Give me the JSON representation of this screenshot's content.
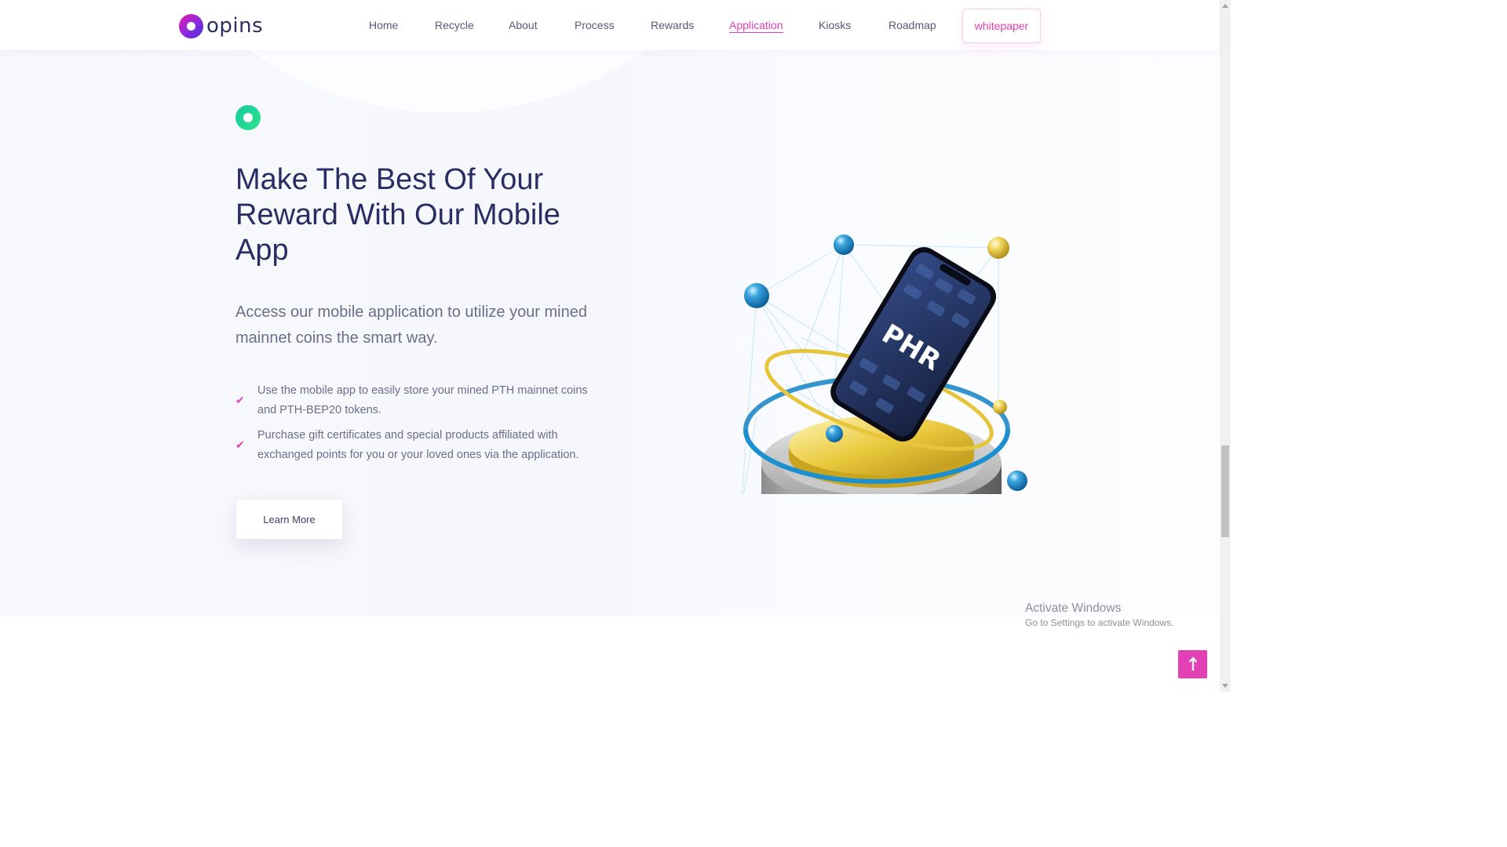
{
  "brand": {
    "name": "opins",
    "accent": "#e43fb1",
    "title_color": "#2a2d63"
  },
  "nav": {
    "items": [
      {
        "label": "Home"
      },
      {
        "label": "Recycle"
      },
      {
        "label": "About"
      },
      {
        "label": "Process"
      },
      {
        "label": "Rewards"
      },
      {
        "label": "Application",
        "active": true
      },
      {
        "label": "Kiosks"
      },
      {
        "label": "Roadmap"
      }
    ],
    "cta_label": "whitepaper"
  },
  "hero": {
    "title": "Make The Best Of Your Reward With Our Mobile App",
    "lead": "Access our mobile application to utilize your mined mainnet coins the smart way.",
    "features": [
      "Use the mobile app to easily store your mined PTH mainnet coins and PTH-BEP20 tokens.",
      "Purchase gift certificates and special products affiliated with exchanged points for you or your loved ones via the application."
    ],
    "button_label": "Learn More",
    "phone_screen_text": "PHR"
  },
  "watermark": {
    "line1": "Activate Windows",
    "line2": "Go to Settings to activate Windows."
  },
  "icons": {
    "feature_check": "check-icon",
    "scroll_top": "arrow-up-icon"
  }
}
